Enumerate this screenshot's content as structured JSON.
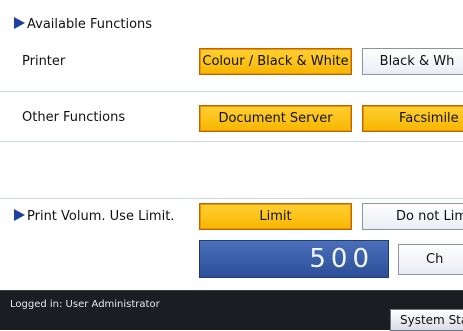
{
  "available_functions": {
    "heading": "Available Functions",
    "printer": {
      "label": "Printer",
      "options": [
        {
          "label": "Colour / Black & White",
          "selected": true
        },
        {
          "label": "Black & Wh",
          "selected": false
        }
      ]
    },
    "other_functions": {
      "label": "Other Functions",
      "options": [
        {
          "label": "Document Server",
          "selected": true
        },
        {
          "label": "Facsimile",
          "selected": true
        }
      ]
    }
  },
  "print_volume_limit": {
    "label": "Print Volum. Use Limit.",
    "options": [
      {
        "label": "Limit",
        "selected": true
      },
      {
        "label": "Do not Lim",
        "selected": false
      }
    ],
    "value": "500",
    "change_button": "Ch"
  },
  "footer": {
    "logged_in": "Logged in: User Administrator",
    "system_status_button": "System Statu"
  },
  "colors": {
    "selected": "#F8B700",
    "selected_border": "#F58E00",
    "accent_blue": "#1F3F9F",
    "counter_blue": "#3A5FAE",
    "footer_bg": "#1B1D22"
  }
}
